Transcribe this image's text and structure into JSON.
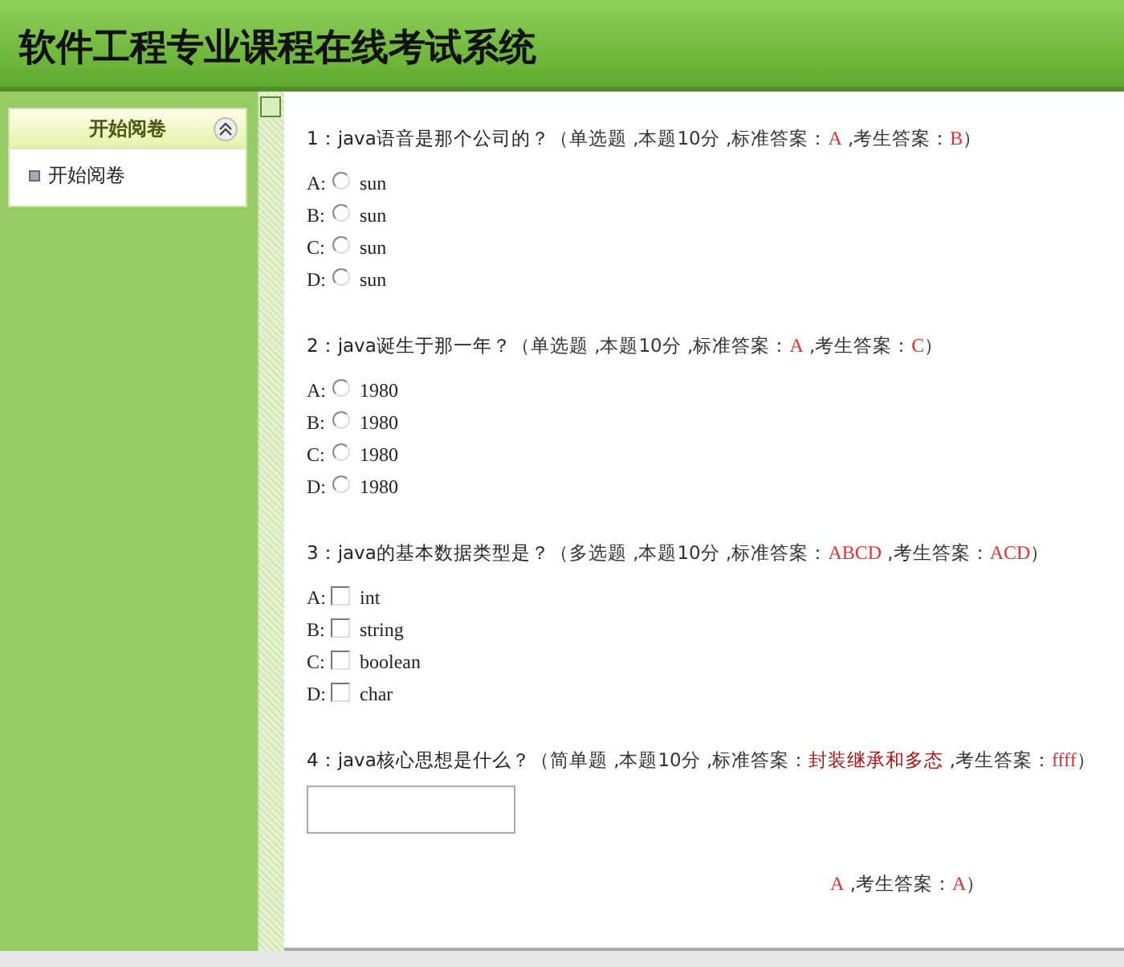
{
  "header": {
    "title": "软件工程专业课程在线考试系统"
  },
  "sidebar": {
    "panel_title": "开始阅卷",
    "expanded": true,
    "items": [
      {
        "label": "开始阅卷"
      }
    ]
  },
  "questions": [
    {
      "kind": "single",
      "heading": [
        {
          "kind": "text",
          "text": "1：java语音是那个公司的？"
        },
        {
          "kind": "meta",
          "text": "（单选题 ,本题10分 ,标准答案："
        },
        {
          "kind": "answer",
          "text": "A"
        },
        {
          "kind": "meta",
          "text": " ,考生答案："
        },
        {
          "kind": "answer",
          "text": "B"
        },
        {
          "kind": "meta",
          "text": "）"
        }
      ],
      "options": [
        {
          "letter": "A:",
          "text": "sun",
          "checked": false
        },
        {
          "letter": "B:",
          "text": "sun",
          "checked": false
        },
        {
          "letter": "C:",
          "text": "sun",
          "checked": false
        },
        {
          "letter": "D:",
          "text": "sun",
          "checked": false
        }
      ]
    },
    {
      "kind": "single",
      "heading": [
        {
          "kind": "text",
          "text": "2：java诞生于那一年？"
        },
        {
          "kind": "meta",
          "text": "（单选题 ,本题10分 ,标准答案："
        },
        {
          "kind": "answer",
          "text": "A"
        },
        {
          "kind": "meta",
          "text": " ,考生答案："
        },
        {
          "kind": "answer",
          "text": "C"
        },
        {
          "kind": "meta",
          "text": "）"
        }
      ],
      "options": [
        {
          "letter": "A:",
          "text": "1980",
          "checked": false
        },
        {
          "letter": "B:",
          "text": "1980",
          "checked": false
        },
        {
          "letter": "C:",
          "text": "1980",
          "checked": false
        },
        {
          "letter": "D:",
          "text": "1980",
          "checked": false
        }
      ]
    },
    {
      "kind": "multiple",
      "heading": [
        {
          "kind": "text",
          "text": "3：java的基本数据类型是？"
        },
        {
          "kind": "meta",
          "text": "（多选题 ,本题10分 ,标准答案："
        },
        {
          "kind": "answer",
          "text": "ABCD"
        },
        {
          "kind": "meta",
          "text": " ,考生答案："
        },
        {
          "kind": "answer",
          "text": "ACD"
        },
        {
          "kind": "meta",
          "text": "）"
        }
      ],
      "options": [
        {
          "letter": "A:",
          "text": "int",
          "checked": false
        },
        {
          "letter": "B:",
          "text": "string",
          "checked": false
        },
        {
          "letter": "C:",
          "text": "boolean",
          "checked": false
        },
        {
          "letter": "D:",
          "text": "char",
          "checked": false
        }
      ]
    },
    {
      "kind": "essay",
      "heading": [
        {
          "kind": "text",
          "text": "4：java核心思想是什么？"
        },
        {
          "kind": "meta",
          "text": "（简单题 ,本题10分 ,标准答案："
        },
        {
          "kind": "answer_dark",
          "text": "封装继承和多态"
        },
        {
          "kind": "meta",
          "text": " ,考生答案："
        },
        {
          "kind": "answer",
          "text": "ffff"
        },
        {
          "kind": "meta",
          "text": "）"
        }
      ]
    },
    {
      "kind": "partial",
      "heading": [
        {
          "kind": "answer",
          "text": "A"
        },
        {
          "kind": "meta",
          "text": " ,考生答案："
        },
        {
          "kind": "answer",
          "text": "A"
        },
        {
          "kind": "meta",
          "text": "）"
        }
      ]
    }
  ]
}
